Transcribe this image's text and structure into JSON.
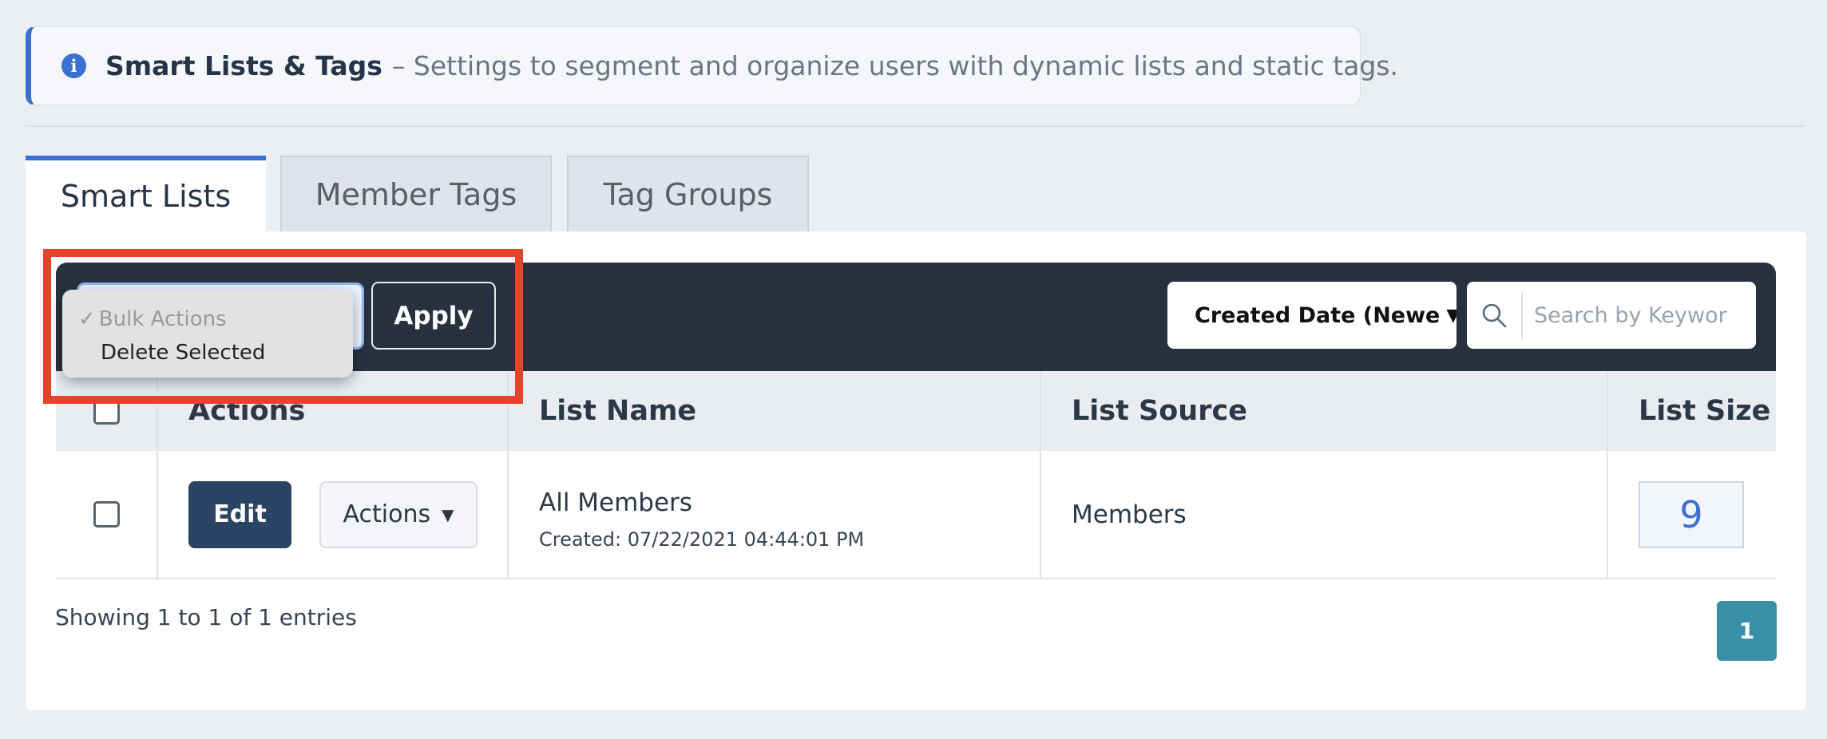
{
  "banner": {
    "title": "Smart Lists & Tags",
    "description": "– Settings to segment and organize users with dynamic lists and static tags."
  },
  "tabs": [
    {
      "label": "Smart Lists",
      "active": true
    },
    {
      "label": "Member Tags",
      "active": false
    },
    {
      "label": "Tag Groups",
      "active": false
    }
  ],
  "toolbar": {
    "apply_label": "Apply",
    "bulk_options": [
      {
        "label": "Bulk Actions",
        "selected": true
      },
      {
        "label": "Delete Selected",
        "selected": false
      }
    ],
    "sort_value": "Created Date (Newe",
    "search_placeholder": "Search by Keywor"
  },
  "table": {
    "headers": [
      "Actions",
      "List Name",
      "List Source",
      "List Size"
    ],
    "rows": [
      {
        "edit_label": "Edit",
        "actions_label": "Actions",
        "list_name": "All Members",
        "created": "Created: 07/22/2021 04:44:01 PM",
        "source": "Members",
        "size": "9"
      }
    ]
  },
  "footer": {
    "entries_text": "Showing 1 to 1 of 1 entries",
    "current_page": "1"
  },
  "colors": {
    "accent": "#3b6fd1",
    "toolbar_bg": "#28323f",
    "edit_button": "#2b4466",
    "highlight": "#e8412c",
    "pagination": "#3a8fa8"
  }
}
